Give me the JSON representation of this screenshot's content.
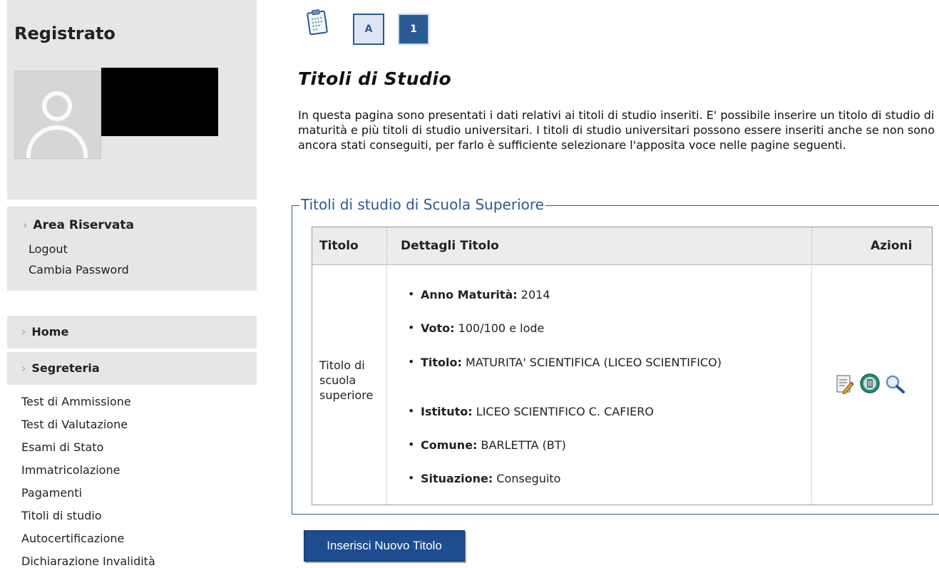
{
  "sidebar": {
    "user_title": "Registrato",
    "area": {
      "title": "Area Riservata",
      "links": [
        "Logout",
        "Cambia Password"
      ]
    },
    "nav": {
      "home": "Home",
      "segreteria": "Segreteria",
      "items": [
        "Test di Ammissione",
        "Test di Valutazione",
        "Esami di Stato",
        "Immatricolazione",
        "Pagamenti",
        "Titoli di studio",
        "Autocertificazione",
        "Dichiarazione Invalidità"
      ]
    }
  },
  "steps": [
    "A",
    "1"
  ],
  "page": {
    "title": "Titoli di Studio",
    "intro": "In questa pagina sono presentati i dati relativi ai titoli di studio inseriti. E' possibile inserire un titolo di studio di maturità e più titoli di studio universitari. I titoli di studio universitari possono essere inseriti anche se non sono ancora stati conseguiti, per farlo è sufficiente selezionare l'apposita voce nelle pagine seguenti."
  },
  "section": {
    "legend": "Titoli di studio di Scuola Superiore",
    "headers": {
      "titolo": "Titolo",
      "dettagli": "Dettagli Titolo",
      "azioni": "Azioni"
    },
    "row": {
      "titolo": "Titolo di scuola superiore",
      "details": [
        {
          "label": "Anno Maturità:",
          "value": "2014"
        },
        {
          "label": "Voto:",
          "value": "100/100 e lode"
        },
        {
          "label": "Titolo:",
          "value": " MATURITA' SCIENTIFICA (LICEO SCIENTIFICO)"
        },
        {
          "label": "Istituto:",
          "value": "LICEO SCIENTIFICO C. CAFIERO"
        },
        {
          "label": "Comune:",
          "value": "BARLETTA (BT)"
        },
        {
          "label": "Situazione:",
          "value": "Conseguito"
        }
      ],
      "actions": [
        "edit-icon",
        "delete-icon",
        "view-icon"
      ]
    }
  },
  "buttons": {
    "insert": "Inserisci Nuovo Titolo"
  },
  "colors": {
    "accent": "#2a5a94",
    "sidebar_bg": "#e6e6e6",
    "button": "#1e4d8f"
  }
}
